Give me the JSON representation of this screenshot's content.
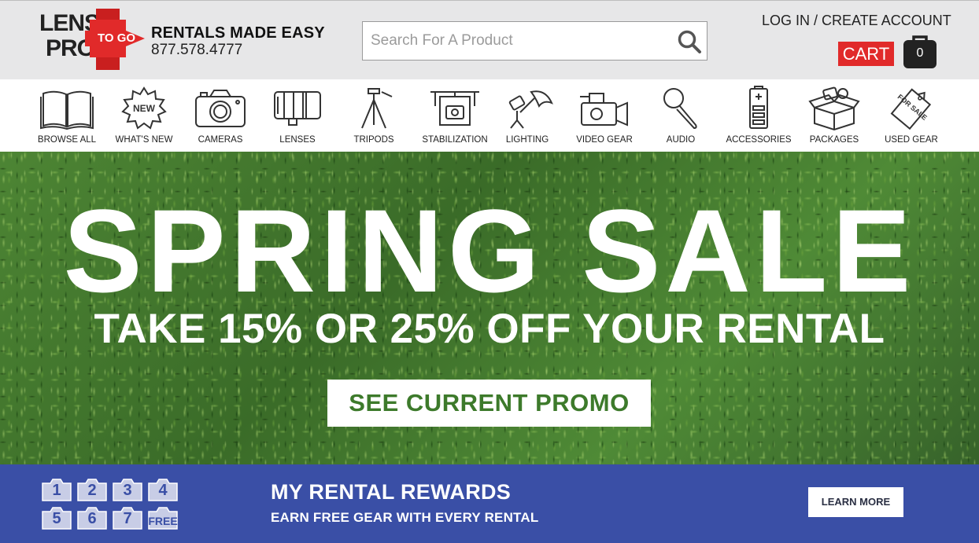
{
  "header": {
    "logo": {
      "line1": "LENS",
      "line2": "PRO",
      "badge": "TO GO"
    },
    "tagline": "RENTALS MADE EASY",
    "phone": "877.578.4777",
    "search": {
      "placeholder": "Search For A Product"
    },
    "account_link": "LOG IN / CREATE ACCOUNT",
    "cart_label": "CART",
    "cart_count": "0",
    "colors": {
      "background": "#e7e7e8",
      "cart_red": "#e12a2a"
    }
  },
  "nav": {
    "items": [
      {
        "label": "BROWSE ALL",
        "icon": "book-icon"
      },
      {
        "label": "WHAT'S NEW",
        "icon": "new-badge-icon",
        "icon_text": "NEW"
      },
      {
        "label": "CAMERAS",
        "icon": "camera-icon"
      },
      {
        "label": "LENSES",
        "icon": "lens-icon"
      },
      {
        "label": "TRIPODS",
        "icon": "tripod-icon"
      },
      {
        "label": "STABILIZATION",
        "icon": "gimbal-icon"
      },
      {
        "label": "LIGHTING",
        "icon": "umbrella-light-icon"
      },
      {
        "label": "VIDEO GEAR",
        "icon": "video-camera-icon"
      },
      {
        "label": "AUDIO",
        "icon": "microphone-icon"
      },
      {
        "label": "ACCESSORIES",
        "icon": "battery-icon"
      },
      {
        "label": "PACKAGES",
        "icon": "package-box-icon"
      },
      {
        "label": "USED GEAR",
        "icon": "for-sale-tag-icon",
        "icon_text": "FOR SALE"
      }
    ]
  },
  "hero": {
    "title": "SPRING SALE",
    "subtitle": "TAKE 15% OR 25% OFF YOUR RENTAL",
    "button": "SEE CURRENT PROMO",
    "colors": {
      "button_text": "#3d7a2b"
    }
  },
  "rewards": {
    "badges": [
      "1",
      "2",
      "3",
      "4",
      "5",
      "6",
      "7",
      "FREE"
    ],
    "title": "MY RENTAL REWARDS",
    "subtitle": "EARN FREE GEAR WITH EVERY RENTAL",
    "button": "LEARN MORE",
    "colors": {
      "background": "#3a4fa6"
    }
  }
}
